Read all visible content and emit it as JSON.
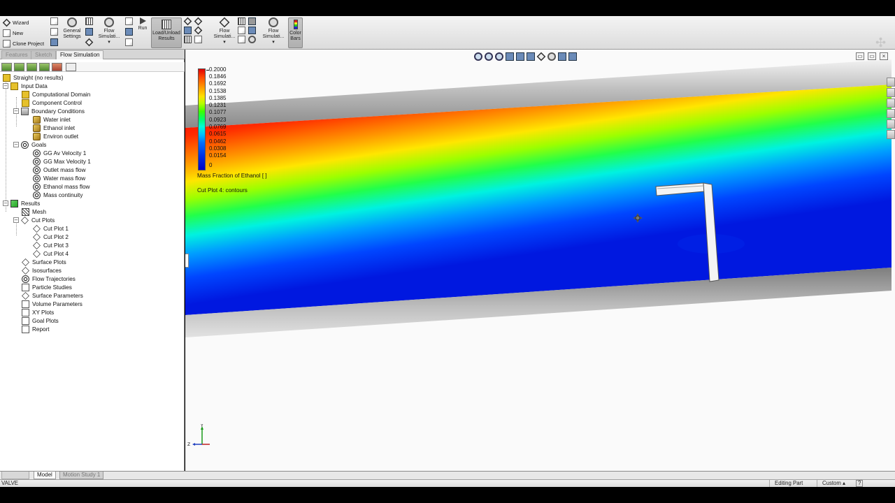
{
  "ribbon": {
    "wizard_label": "Wizard",
    "new_label": "New",
    "clone_project_label": "Clone Project",
    "general_settings_label": "General Settings",
    "flow_simulation_1_label": "Flow Simulati...",
    "run_label": "Run",
    "load_unload_label": "Load/Unload Results",
    "flow_simulation_2_label": "Flow Simulati...",
    "flow_simulation_3_label": "Flow Simulati...",
    "color_bars_label": "Color Bars"
  },
  "left_panel": {
    "tabs": [
      "Features",
      "Sketch",
      "Flow Simulation"
    ],
    "active_tab": "Flow Simulation"
  },
  "tree": {
    "root": "Straight (no results)",
    "input_data": "Input Data",
    "computational_domain": "Computational Domain",
    "component_control": "Component Control",
    "boundary_conditions": "Boundary Conditions",
    "water_inlet": "Water inlet",
    "ethanol_inlet": "Ethanol inlet",
    "environ_outlet": "Environ outlet",
    "goals": "Goals",
    "gg_av_velocity": "GG Av Velocity 1",
    "gg_max_velocity": "GG Max Velocity 1",
    "outlet_mass_flow": "Outlet mass flow",
    "water_mass_flow": "Water mass flow",
    "ethanol_mass_flow": "Ethanol mass flow",
    "mass_continuity": "Mass continuity",
    "results": "Results",
    "mesh": "Mesh",
    "cut_plots": "Cut Plots",
    "cut_plot_1": "Cut Plot 1",
    "cut_plot_2": "Cut Plot 2",
    "cut_plot_3": "Cut Plot 3",
    "cut_plot_4": "Cut Plot 4",
    "surface_plots": "Surface Plots",
    "isosurfaces": "Isosurfaces",
    "flow_trajectories": "Flow Trajectories",
    "particle_studies": "Particle Studies",
    "surface_parameters": "Surface Parameters",
    "volume_parameters": "Volume Parameters",
    "xy_plots": "XY Plots",
    "goal_plots": "Goal Plots",
    "report": "Report"
  },
  "legend": {
    "values": [
      "0.2000",
      "0.1846",
      "0.1692",
      "0.1538",
      "0.1385",
      "0.1231",
      "0.1077",
      "0.0923",
      "0.0769",
      "0.0615",
      "0.0462",
      "0.0308",
      "0.0154",
      "0"
    ],
    "title": "Mass Fraction of Ethanol [ ]",
    "subtitle": "Cut Plot 4: contours",
    "colors": {
      "max": "#e00000",
      "mid": "#3cff00",
      "min": "#0000c8"
    }
  },
  "triad": {
    "y": "Y",
    "z": "Z"
  },
  "bottom_tabs": {
    "model": "Model",
    "motion_study": "Motion Study 1"
  },
  "status": {
    "part_name": "VALVE",
    "mode": "Editing Part",
    "units": "Custom",
    "help": "?"
  }
}
